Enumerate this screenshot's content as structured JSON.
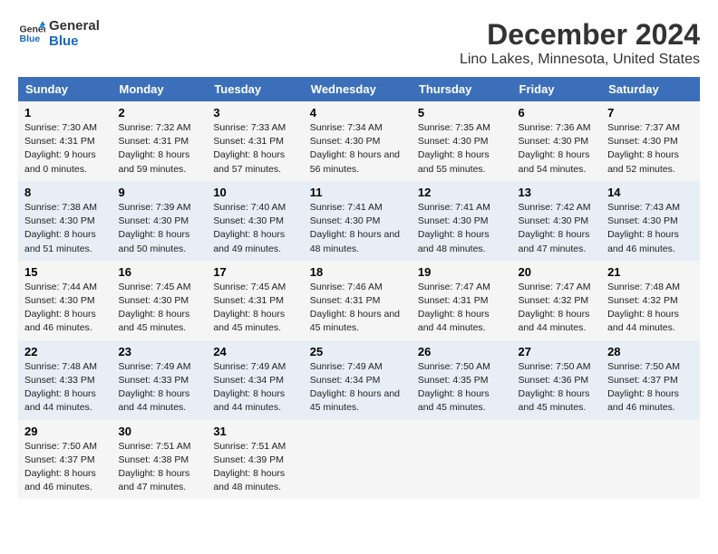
{
  "header": {
    "logo_line1": "General",
    "logo_line2": "Blue",
    "main_title": "December 2024",
    "subtitle": "Lino Lakes, Minnesota, United States"
  },
  "days_of_week": [
    "Sunday",
    "Monday",
    "Tuesday",
    "Wednesday",
    "Thursday",
    "Friday",
    "Saturday"
  ],
  "weeks": [
    [
      {
        "day": "1",
        "sunrise": "Sunrise: 7:30 AM",
        "sunset": "Sunset: 4:31 PM",
        "daylight": "Daylight: 9 hours and 0 minutes."
      },
      {
        "day": "2",
        "sunrise": "Sunrise: 7:32 AM",
        "sunset": "Sunset: 4:31 PM",
        "daylight": "Daylight: 8 hours and 59 minutes."
      },
      {
        "day": "3",
        "sunrise": "Sunrise: 7:33 AM",
        "sunset": "Sunset: 4:31 PM",
        "daylight": "Daylight: 8 hours and 57 minutes."
      },
      {
        "day": "4",
        "sunrise": "Sunrise: 7:34 AM",
        "sunset": "Sunset: 4:30 PM",
        "daylight": "Daylight: 8 hours and 56 minutes."
      },
      {
        "day": "5",
        "sunrise": "Sunrise: 7:35 AM",
        "sunset": "Sunset: 4:30 PM",
        "daylight": "Daylight: 8 hours and 55 minutes."
      },
      {
        "day": "6",
        "sunrise": "Sunrise: 7:36 AM",
        "sunset": "Sunset: 4:30 PM",
        "daylight": "Daylight: 8 hours and 54 minutes."
      },
      {
        "day": "7",
        "sunrise": "Sunrise: 7:37 AM",
        "sunset": "Sunset: 4:30 PM",
        "daylight": "Daylight: 8 hours and 52 minutes."
      }
    ],
    [
      {
        "day": "8",
        "sunrise": "Sunrise: 7:38 AM",
        "sunset": "Sunset: 4:30 PM",
        "daylight": "Daylight: 8 hours and 51 minutes."
      },
      {
        "day": "9",
        "sunrise": "Sunrise: 7:39 AM",
        "sunset": "Sunset: 4:30 PM",
        "daylight": "Daylight: 8 hours and 50 minutes."
      },
      {
        "day": "10",
        "sunrise": "Sunrise: 7:40 AM",
        "sunset": "Sunset: 4:30 PM",
        "daylight": "Daylight: 8 hours and 49 minutes."
      },
      {
        "day": "11",
        "sunrise": "Sunrise: 7:41 AM",
        "sunset": "Sunset: 4:30 PM",
        "daylight": "Daylight: 8 hours and 48 minutes."
      },
      {
        "day": "12",
        "sunrise": "Sunrise: 7:41 AM",
        "sunset": "Sunset: 4:30 PM",
        "daylight": "Daylight: 8 hours and 48 minutes."
      },
      {
        "day": "13",
        "sunrise": "Sunrise: 7:42 AM",
        "sunset": "Sunset: 4:30 PM",
        "daylight": "Daylight: 8 hours and 47 minutes."
      },
      {
        "day": "14",
        "sunrise": "Sunrise: 7:43 AM",
        "sunset": "Sunset: 4:30 PM",
        "daylight": "Daylight: 8 hours and 46 minutes."
      }
    ],
    [
      {
        "day": "15",
        "sunrise": "Sunrise: 7:44 AM",
        "sunset": "Sunset: 4:30 PM",
        "daylight": "Daylight: 8 hours and 46 minutes."
      },
      {
        "day": "16",
        "sunrise": "Sunrise: 7:45 AM",
        "sunset": "Sunset: 4:30 PM",
        "daylight": "Daylight: 8 hours and 45 minutes."
      },
      {
        "day": "17",
        "sunrise": "Sunrise: 7:45 AM",
        "sunset": "Sunset: 4:31 PM",
        "daylight": "Daylight: 8 hours and 45 minutes."
      },
      {
        "day": "18",
        "sunrise": "Sunrise: 7:46 AM",
        "sunset": "Sunset: 4:31 PM",
        "daylight": "Daylight: 8 hours and 45 minutes."
      },
      {
        "day": "19",
        "sunrise": "Sunrise: 7:47 AM",
        "sunset": "Sunset: 4:31 PM",
        "daylight": "Daylight: 8 hours and 44 minutes."
      },
      {
        "day": "20",
        "sunrise": "Sunrise: 7:47 AM",
        "sunset": "Sunset: 4:32 PM",
        "daylight": "Daylight: 8 hours and 44 minutes."
      },
      {
        "day": "21",
        "sunrise": "Sunrise: 7:48 AM",
        "sunset": "Sunset: 4:32 PM",
        "daylight": "Daylight: 8 hours and 44 minutes."
      }
    ],
    [
      {
        "day": "22",
        "sunrise": "Sunrise: 7:48 AM",
        "sunset": "Sunset: 4:33 PM",
        "daylight": "Daylight: 8 hours and 44 minutes."
      },
      {
        "day": "23",
        "sunrise": "Sunrise: 7:49 AM",
        "sunset": "Sunset: 4:33 PM",
        "daylight": "Daylight: 8 hours and 44 minutes."
      },
      {
        "day": "24",
        "sunrise": "Sunrise: 7:49 AM",
        "sunset": "Sunset: 4:34 PM",
        "daylight": "Daylight: 8 hours and 44 minutes."
      },
      {
        "day": "25",
        "sunrise": "Sunrise: 7:49 AM",
        "sunset": "Sunset: 4:34 PM",
        "daylight": "Daylight: 8 hours and 45 minutes."
      },
      {
        "day": "26",
        "sunrise": "Sunrise: 7:50 AM",
        "sunset": "Sunset: 4:35 PM",
        "daylight": "Daylight: 8 hours and 45 minutes."
      },
      {
        "day": "27",
        "sunrise": "Sunrise: 7:50 AM",
        "sunset": "Sunset: 4:36 PM",
        "daylight": "Daylight: 8 hours and 45 minutes."
      },
      {
        "day": "28",
        "sunrise": "Sunrise: 7:50 AM",
        "sunset": "Sunset: 4:37 PM",
        "daylight": "Daylight: 8 hours and 46 minutes."
      }
    ],
    [
      {
        "day": "29",
        "sunrise": "Sunrise: 7:50 AM",
        "sunset": "Sunset: 4:37 PM",
        "daylight": "Daylight: 8 hours and 46 minutes."
      },
      {
        "day": "30",
        "sunrise": "Sunrise: 7:51 AM",
        "sunset": "Sunset: 4:38 PM",
        "daylight": "Daylight: 8 hours and 47 minutes."
      },
      {
        "day": "31",
        "sunrise": "Sunrise: 7:51 AM",
        "sunset": "Sunset: 4:39 PM",
        "daylight": "Daylight: 8 hours and 48 minutes."
      },
      null,
      null,
      null,
      null
    ]
  ]
}
